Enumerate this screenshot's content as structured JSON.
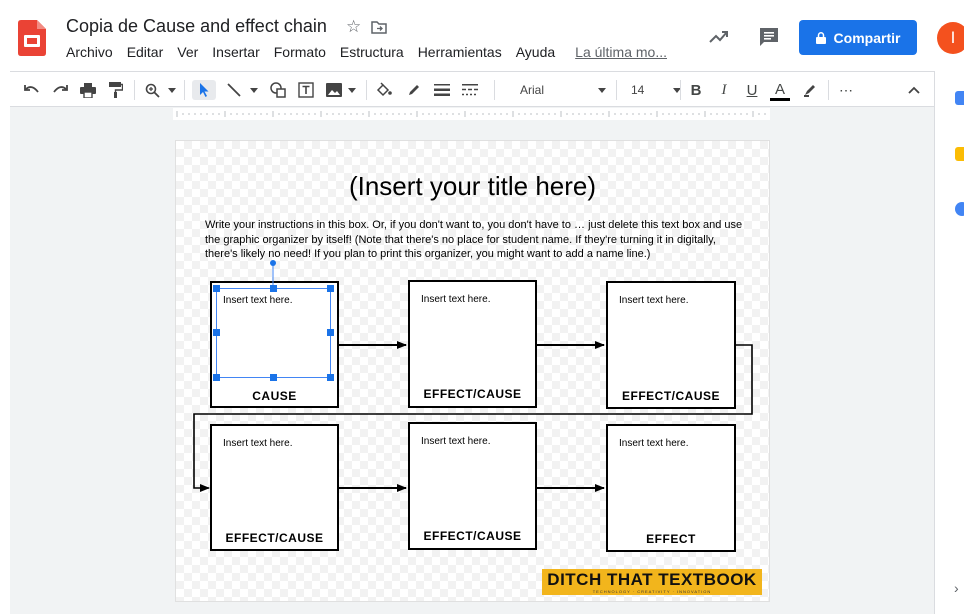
{
  "app": {
    "doc_title": "Copia de Cause and effect chain",
    "menus": [
      "Archivo",
      "Editar",
      "Ver",
      "Insertar",
      "Formato",
      "Estructura",
      "Herramientas",
      "Ayuda"
    ],
    "last_edit": "La última mo...",
    "share_label": "Compartir",
    "avatar_initial": "I",
    "accent_color": "#1a73e8",
    "avatar_color": "#f4511e",
    "logo_color": "#ea4335"
  },
  "toolbar": {
    "font_name": "Arial",
    "font_size": "14",
    "bold": "B",
    "italic": "I",
    "underline": "U",
    "text_color": "A",
    "more": "⋯",
    "collapse": "^"
  },
  "slide": {
    "title": "(Insert your title here)",
    "instructions": "Write your instructions in this box. Or, if you don't want to, you don't have to … just delete this text box and use the graphic organizer by itself! (Note that there's no place for student name. If they're turning it in digitally, there's likely no need! If you plan to print this organizer, you might want to add a name line.)",
    "boxes": [
      {
        "text": "Insert text here.",
        "label": "CAUSE"
      },
      {
        "text": "Insert text here.",
        "label": "EFFECT/CAUSE"
      },
      {
        "text": "Insert text here.",
        "label": "EFFECT/CAUSE"
      },
      {
        "text": "Insert text here.",
        "label": "EFFECT/CAUSE"
      },
      {
        "text": "Insert text here.",
        "label": "EFFECT/CAUSE"
      },
      {
        "text": "Insert text here.",
        "label": "EFFECT"
      }
    ],
    "logo_text": "DITCH THAT TEXTBOOK",
    "logo_subtext": "TECHNOLOGY · CREATIVITY · INNOVATION",
    "logo_banner_color": "#f2b51c"
  },
  "side_panel": {
    "icons": [
      "calendar-icon",
      "keep-icon",
      "tasks-icon"
    ],
    "chevron": "›"
  }
}
